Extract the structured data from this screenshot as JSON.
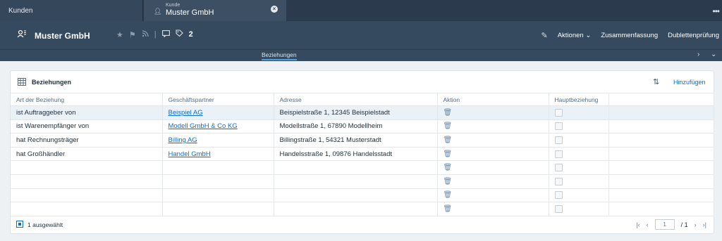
{
  "tabs": [
    {
      "label": "Kunden"
    },
    {
      "kicker": "Kunde",
      "label": "Muster GmbH"
    }
  ],
  "header": {
    "title": "Muster GmbH",
    "count": "2",
    "actions": [
      "Aktionen",
      "Zusammenfassung",
      "Dublettenprüfung"
    ]
  },
  "anchors": {
    "active": "Beziehungen"
  },
  "card": {
    "title": "Beziehungen",
    "add_label": "Hinzufügen",
    "columns": [
      "Art der Beziehung",
      "Geschäftspartner",
      "Adresse",
      "Aktion",
      "Hauptbeziehung"
    ],
    "rows": [
      {
        "type": "ist Auftraggeber von",
        "partner": "Beispiel AG",
        "address": "Beispielstraße 1, 12345 Beispielstadt"
      },
      {
        "type": "ist Warenempfänger von",
        "partner": "Modell GmbH & Co KG",
        "address": "Modellstraße 1, 67890 Modellheim"
      },
      {
        "type": "hat Rechnungsträger",
        "partner": "Billing AG",
        "address": "Billingstraße 1, 54321 Musterstadt"
      },
      {
        "type": "hat Großhändler",
        "partner": "Handel GmbH",
        "address": "Handelsstraße 1, 09876 Handelsstadt"
      }
    ],
    "footer": {
      "selected": "1 ausgewählt",
      "page": "1",
      "of": "/ 1"
    }
  }
}
